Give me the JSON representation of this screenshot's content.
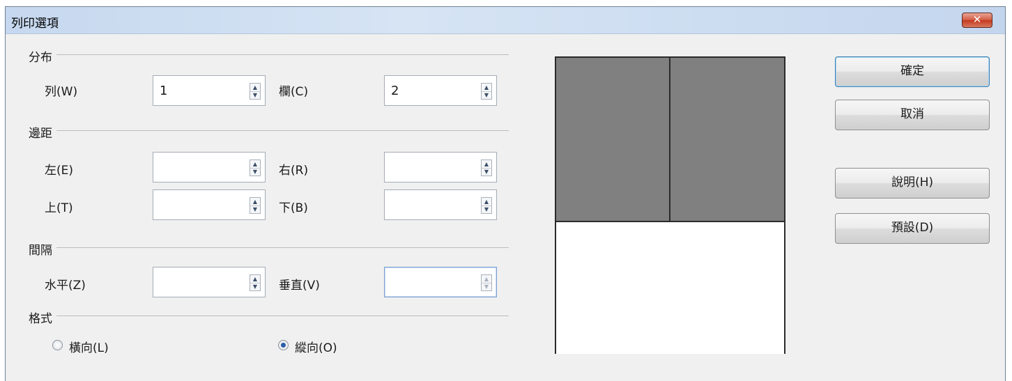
{
  "window": {
    "title": "列印選項",
    "close_label": "✕"
  },
  "groups": {
    "distribution": "分布",
    "margins": "邊距",
    "spacing": "間隔",
    "format": "格式"
  },
  "fields": {
    "rows_label": "列(W)",
    "rows_value": "1",
    "columns_label": "欄(C)",
    "columns_value": "2",
    "left_label": "左(E)",
    "left_value": "",
    "right_label": "右(R)",
    "right_value": "",
    "top_label": "上(T)",
    "top_value": "",
    "bottom_label": "下(B)",
    "bottom_value": "",
    "horizontal_label": "水平(Z)",
    "horizontal_value": "",
    "vertical_label": "垂直(V)",
    "vertical_value": ""
  },
  "orientation": {
    "landscape_label": "橫向(L)",
    "portrait_label": "縱向(O)",
    "selected": "portrait"
  },
  "buttons": {
    "ok": "確定",
    "cancel": "取消",
    "help": "說明(H)",
    "default": "預設(D)"
  },
  "preview": {
    "rows": 1,
    "columns": 2,
    "fill_color": "#808080"
  },
  "icons": {
    "spin_up": "▲",
    "spin_down": "▼"
  }
}
